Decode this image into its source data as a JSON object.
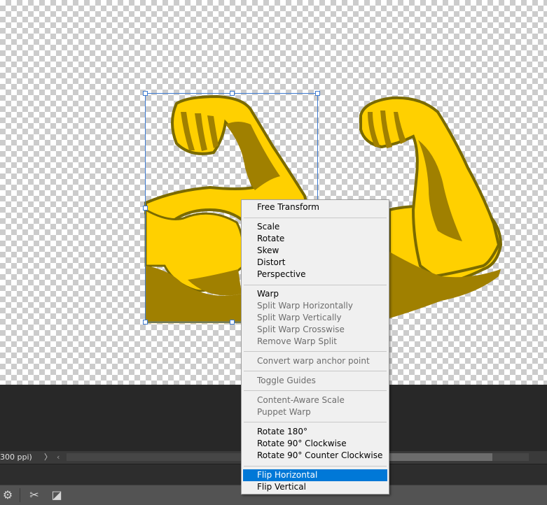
{
  "canvas": {
    "transparency": "checkerboard",
    "arm_color": "#ffd000",
    "arm_shadow_color": "#a08000",
    "arm_outline_color": "#7a6a00",
    "selection_color": "#3d7ad0"
  },
  "status_bar": {
    "zoom_text": "300 ppi)",
    "next_arrow": "〉",
    "prev_arrow": "‹"
  },
  "bottom_toolbar": {
    "icons": [
      "gear-icon",
      "scissors-icon",
      "mask-icon"
    ],
    "gear_glyph": "⚙",
    "scissors_glyph": "✂",
    "mask_glyph": "◪"
  },
  "context_menu": {
    "highlight_color": "#0078d7",
    "items": [
      {
        "label": "Free Transform",
        "enabled": true
      },
      {
        "label": "Scale",
        "enabled": true
      },
      {
        "label": "Rotate",
        "enabled": true
      },
      {
        "label": "Skew",
        "enabled": true
      },
      {
        "label": "Distort",
        "enabled": true
      },
      {
        "label": "Perspective",
        "enabled": true
      },
      {
        "label": "Warp",
        "enabled": true
      },
      {
        "label": "Split Warp Horizontally",
        "enabled": false
      },
      {
        "label": "Split Warp Vertically",
        "enabled": false
      },
      {
        "label": "Split Warp Crosswise",
        "enabled": false
      },
      {
        "label": "Remove Warp Split",
        "enabled": false
      },
      {
        "label": "Convert warp anchor point",
        "enabled": false
      },
      {
        "label": "Toggle Guides",
        "enabled": false
      },
      {
        "label": "Content-Aware Scale",
        "enabled": false
      },
      {
        "label": "Puppet Warp",
        "enabled": false
      },
      {
        "label": "Rotate 180°",
        "enabled": true
      },
      {
        "label": "Rotate 90° Clockwise",
        "enabled": true
      },
      {
        "label": "Rotate 90° Counter Clockwise",
        "enabled": true
      },
      {
        "label": "Flip Horizontal",
        "enabled": true,
        "highlighted": true
      },
      {
        "label": "Flip Vertical",
        "enabled": true
      }
    ]
  }
}
